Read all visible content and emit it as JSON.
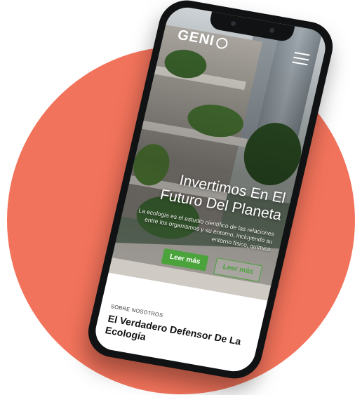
{
  "brand": {
    "logo_text": "GENI",
    "accent": "#4aa33b",
    "background_circle": "#f2735b"
  },
  "header": {
    "menu_icon": "hamburger-icon"
  },
  "hero": {
    "title": "Invertimos En El Futuro Del Planeta",
    "text": "La ecología es el estudio científico de las relaciones entre los organismos y su entorno, incluyendo su entorno físico, químico",
    "primary_button": "Leer más",
    "secondary_button": "Leer más"
  },
  "about": {
    "eyebrow": "SOBRE NOSOTROS",
    "title": "El Verdadero Defensor De La Ecología"
  }
}
